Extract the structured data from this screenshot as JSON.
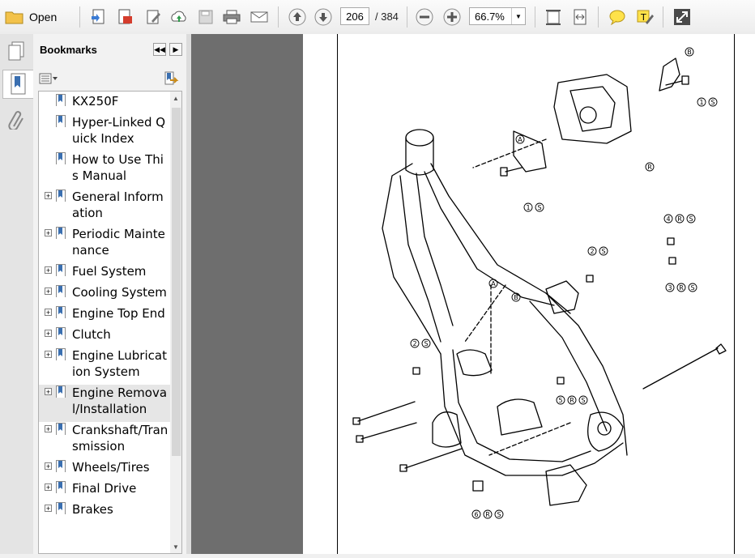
{
  "toolbar": {
    "open_label": "Open",
    "page_current": "206",
    "page_total": "/ 384",
    "zoom": "66.7%",
    "icons": [
      "folder-icon",
      "create-pdf-icon",
      "save-pdf-icon",
      "edit-icon",
      "upload-icon",
      "save-icon",
      "print-icon",
      "email-icon",
      "prev-page-icon",
      "next-page-icon",
      "zoom-out-icon",
      "zoom-in-icon",
      "fit-page-icon",
      "fit-width-icon",
      "comment-icon",
      "highlight-icon",
      "expand-icon"
    ]
  },
  "panel": {
    "title": "Bookmarks",
    "bookmarks": [
      {
        "label": "KX250F",
        "expandable": false
      },
      {
        "label": "Hyper-Linked Quick Index",
        "expandable": false
      },
      {
        "label": "How to Use This Manual",
        "expandable": false
      },
      {
        "label": "General Information",
        "expandable": true
      },
      {
        "label": "Periodic Maintenance",
        "expandable": true
      },
      {
        "label": "Fuel System",
        "expandable": true
      },
      {
        "label": "Cooling System",
        "expandable": true
      },
      {
        "label": "Engine Top End",
        "expandable": true
      },
      {
        "label": "Clutch",
        "expandable": true
      },
      {
        "label": "Engine Lubrication System",
        "expandable": true
      },
      {
        "label": "Engine Removal/Installation",
        "expandable": true,
        "selected": true
      },
      {
        "label": "Crankshaft/Transmission",
        "expandable": true
      },
      {
        "label": "Wheels/Tires",
        "expandable": true
      },
      {
        "label": "Final Drive",
        "expandable": true
      },
      {
        "label": "Brakes",
        "expandable": true
      }
    ]
  },
  "diagram": {
    "callouts": [
      "A",
      "B",
      "1",
      "S",
      "R",
      "4",
      "2",
      "3",
      "5",
      "6"
    ]
  }
}
